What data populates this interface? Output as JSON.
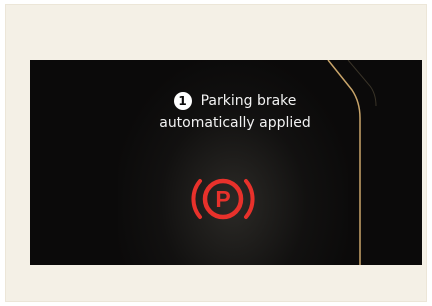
{
  "notification": {
    "step_number": "1",
    "line1": "Parking brake",
    "line2": "automatically applied"
  },
  "indicator": {
    "icon": "parking-brake-icon",
    "letter": "P",
    "color": "#e8312b"
  },
  "colors": {
    "screen_background": "#0b0a0a",
    "accent_edge": "#c9a56a",
    "page_background": "#f4f0e6"
  }
}
